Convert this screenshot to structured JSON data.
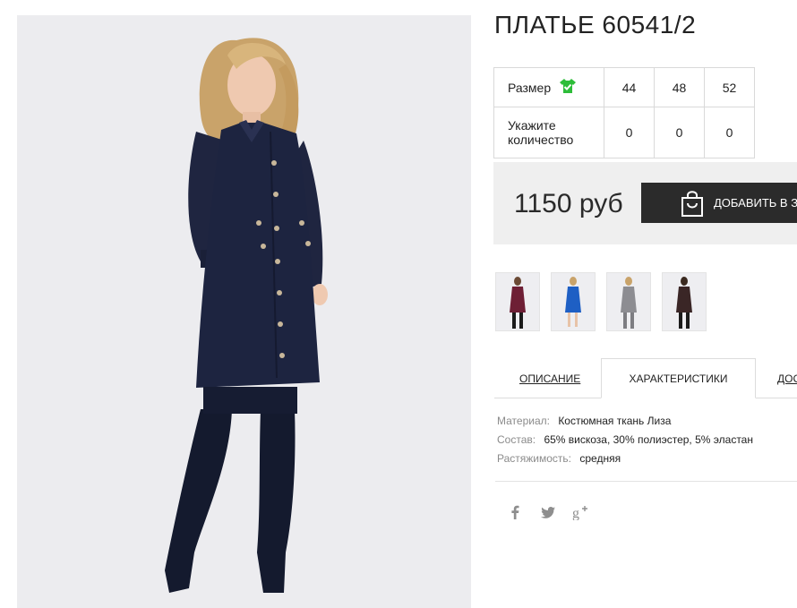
{
  "product": {
    "title": "ПЛАТЬЕ 60541/2",
    "image_alt": "",
    "main_photo_background": "#ececef"
  },
  "size_table": {
    "size_label": "Размер",
    "size_icon": "green-dress-check-icon",
    "size_icon_color": "#2ebd3a",
    "sizes": [
      "44",
      "48",
      "52"
    ],
    "quantity_label": "Укажите количество",
    "quantities": [
      "0",
      "0",
      "0"
    ]
  },
  "purchase": {
    "price": "1150 руб",
    "button_label": "ДОБАВИТЬ В ЗАКАЗ",
    "button_icon": "shopping-bag-icon",
    "button_color": "#2b2b2b"
  },
  "color_variants": [
    {
      "name": "burgundy",
      "color": "#6e1f35"
    },
    {
      "name": "blue",
      "color": "#1e5fc4"
    },
    {
      "name": "grey",
      "color": "#8d8d92"
    },
    {
      "name": "dark-brown",
      "color": "#3a2626"
    }
  ],
  "tabs": [
    {
      "label": "ОПИСАНИЕ",
      "active": false
    },
    {
      "label": "ХАРАКТЕРИСТИКИ",
      "active": true
    },
    {
      "label": "ДОСТАВКА",
      "active": false
    }
  ],
  "characteristics": [
    {
      "key": "Материал:",
      "value": "Костюмная ткань Лиза"
    },
    {
      "key": "Состав:",
      "value": "65% вискоза, 30% полиэстер, 5% эластан"
    },
    {
      "key": "Растяжимость:",
      "value": "средняя"
    }
  ],
  "share": [
    {
      "network": "facebook",
      "icon": "facebook-icon"
    },
    {
      "network": "twitter",
      "icon": "twitter-icon"
    },
    {
      "network": "google-plus",
      "icon": "google-plus-icon"
    }
  ]
}
